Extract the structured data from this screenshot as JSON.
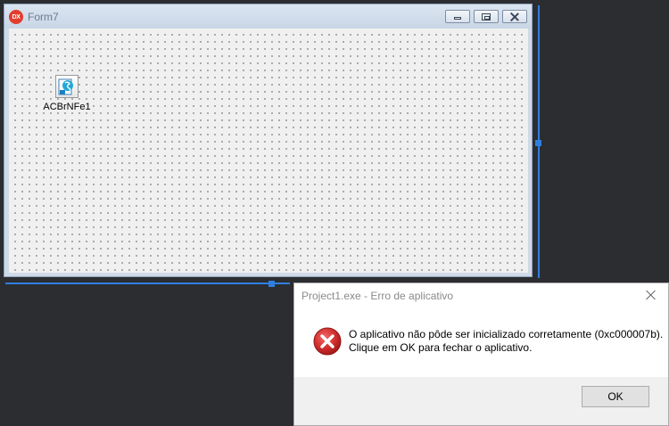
{
  "form_window": {
    "title": "Form7",
    "logo_text": "DX",
    "component": {
      "label": "ACBrNFe1",
      "icon": "acbr-nfe-component-icon"
    }
  },
  "error_dialog": {
    "title": "Project1.exe - Erro de aplicativo",
    "message_line1": "O aplicativo não pôde ser inicializado corretamente (0xc000007b).",
    "message_line2": "Clique em OK para fechar o aplicativo.",
    "ok_label": "OK",
    "icon": "error-icon"
  },
  "colors": {
    "background": "#2b2d30",
    "selection_guide": "#2f7fe0",
    "error_red": "#d32f2f"
  }
}
